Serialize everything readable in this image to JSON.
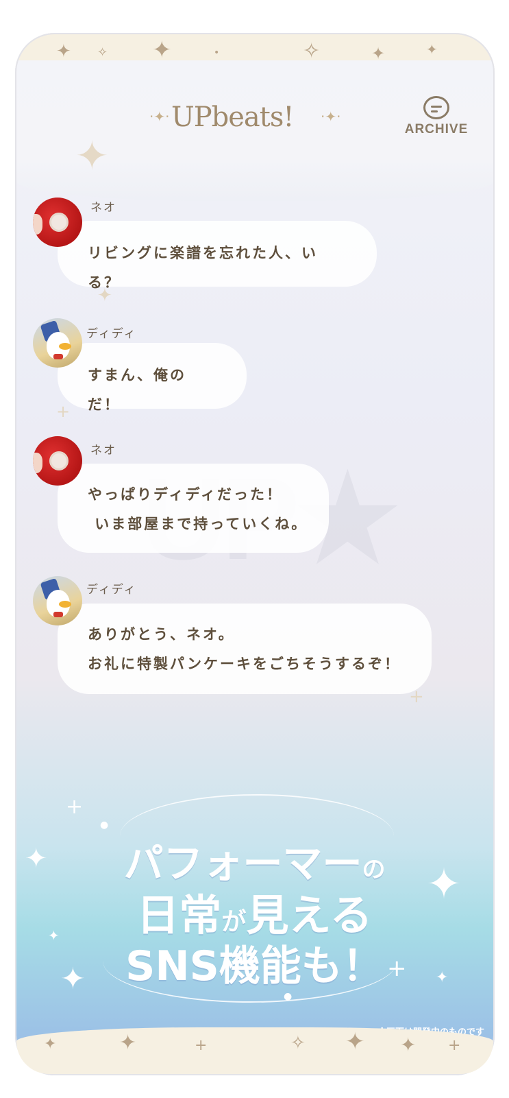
{
  "app": {
    "logo": "UPbeats!",
    "archive_label": "ARCHIVE",
    "archive_icon": "chat-bubble-icon"
  },
  "messages": [
    {
      "sender": "ネオ",
      "avatar": "neo-avatar",
      "text_lines": [
        "リビングに楽譜を忘れた人、いる？"
      ]
    },
    {
      "sender": "ディディ",
      "avatar": "didi-avatar",
      "text_lines": [
        "すまん、俺のだ！"
      ]
    },
    {
      "sender": "ネオ",
      "avatar": "neo-avatar",
      "text_lines": [
        "やっぱりディディだった！",
        " いま部屋まで持っていくね。"
      ]
    },
    {
      "sender": "ディディ",
      "avatar": "didi-avatar",
      "text_lines": [
        "ありがとう、ネオ。",
        "お礼に特製パンケーキをごちそうするぞ！"
      ]
    }
  ],
  "promo": {
    "line1_main": "パフォーマー",
    "line1_small": "の",
    "line2_a": "日常",
    "line2_small": "が",
    "line2_b": "見える",
    "line3": "SNS機能も！"
  },
  "footnote": "※画面は開発中のものです",
  "colors": {
    "bubble_text": "#5e4f3c",
    "accent_gold": "#b9a489",
    "promo_text": "#ffffff"
  }
}
